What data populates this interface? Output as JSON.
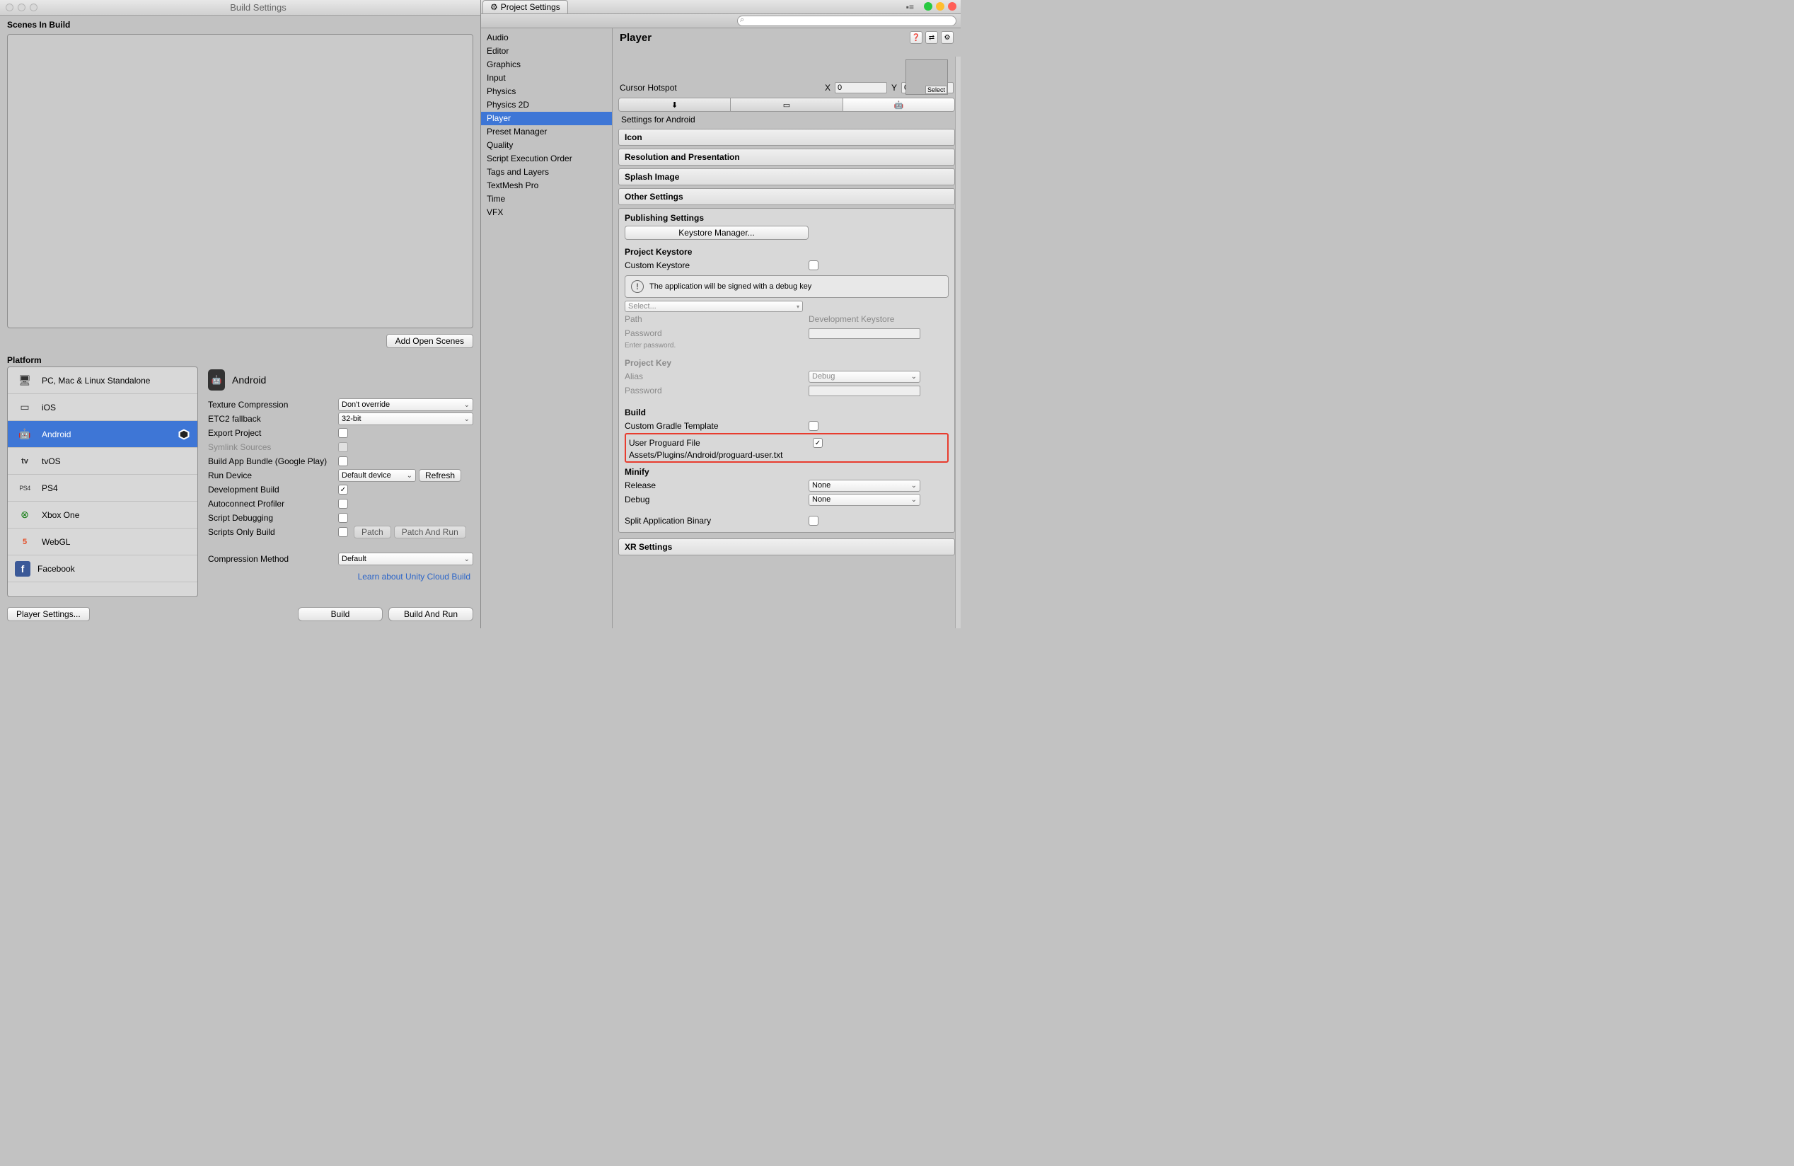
{
  "build": {
    "title": "Build Settings",
    "scenes_label": "Scenes In Build",
    "add_open": "Add Open Scenes",
    "platform_label": "Platform",
    "platforms": [
      {
        "name": "PC, Mac & Linux Standalone"
      },
      {
        "name": "iOS"
      },
      {
        "name": "Android"
      },
      {
        "name": "tvOS"
      },
      {
        "name": "PS4"
      },
      {
        "name": "Xbox One"
      },
      {
        "name": "WebGL"
      },
      {
        "name": "Facebook"
      }
    ],
    "selected_platform": "Android",
    "detail_title": "Android",
    "fields": {
      "texture_compression": {
        "label": "Texture Compression",
        "value": "Don't override"
      },
      "etc2": {
        "label": "ETC2 fallback",
        "value": "32-bit"
      },
      "export_project": {
        "label": "Export Project"
      },
      "symlink": {
        "label": "Symlink Sources"
      },
      "app_bundle": {
        "label": "Build App Bundle (Google Play)"
      },
      "run_device": {
        "label": "Run Device",
        "value": "Default device",
        "refresh": "Refresh"
      },
      "dev_build": {
        "label": "Development Build"
      },
      "autoconnect": {
        "label": "Autoconnect Profiler"
      },
      "script_debug": {
        "label": "Script Debugging"
      },
      "scripts_only": {
        "label": "Scripts Only Build",
        "patch": "Patch",
        "patch_run": "Patch And Run"
      },
      "compression": {
        "label": "Compression Method",
        "value": "Default"
      }
    },
    "cloud_link": "Learn about Unity Cloud Build",
    "player_settings_btn": "Player Settings...",
    "build_btn": "Build",
    "build_run_btn": "Build And Run"
  },
  "proj": {
    "tab_title": "Project Settings",
    "categories": [
      "Audio",
      "Editor",
      "Graphics",
      "Input",
      "Physics",
      "Physics 2D",
      "Player",
      "Preset Manager",
      "Quality",
      "Script Execution Order",
      "Tags and Layers",
      "TextMesh Pro",
      "Time",
      "VFX"
    ],
    "selected_category": "Player",
    "detail_title": "Player",
    "swatch_select": "Select",
    "cursor": {
      "label": "Cursor Hotspot",
      "x_label": "X",
      "x": "0",
      "y_label": "Y",
      "y": "0"
    },
    "settings_for": "Settings for Android",
    "folds": [
      "Icon",
      "Resolution and Presentation",
      "Splash Image",
      "Other Settings"
    ],
    "publishing": {
      "title": "Publishing Settings",
      "keystore_mgr": "Keystore Manager...",
      "project_keystore": "Project Keystore",
      "custom_keystore": "Custom Keystore",
      "info": "The application will be signed with a debug key",
      "select": "Select...",
      "path_lbl": "Path",
      "path_val": "Development Keystore",
      "password_lbl": "Password",
      "enter_pw": "Enter password.",
      "project_key": "Project Key",
      "alias_lbl": "Alias",
      "alias_val": "Debug",
      "password2_lbl": "Password",
      "build": "Build",
      "gradle": "Custom Gradle Template",
      "proguard_lbl": "User Proguard File",
      "proguard_path": "Assets/Plugins/Android/proguard-user.txt",
      "minify": "Minify",
      "release_lbl": "Release",
      "release_val": "None",
      "debug_lbl": "Debug",
      "debug_val": "None",
      "split_binary": "Split Application Binary"
    },
    "xr": "XR Settings"
  }
}
